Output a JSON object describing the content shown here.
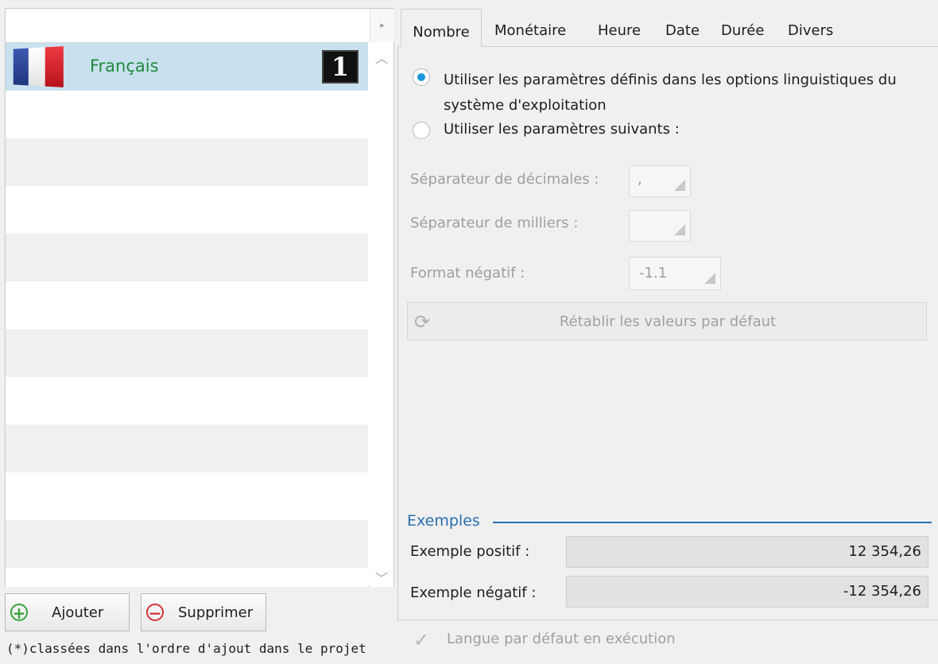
{
  "languages": {
    "items": [
      {
        "name": "Français",
        "order": "1",
        "flag_icon": "france-flag-icon"
      }
    ],
    "header_arrow": "▸",
    "scroll_up": "︿",
    "scroll_down": "﹀"
  },
  "buttons": {
    "add_label": "Ajouter",
    "add_icon": "+",
    "remove_label": "Supprimer",
    "remove_icon": "−"
  },
  "footnote": "(*)classées dans l'ordre d'ajout dans le projet",
  "tabs": [
    {
      "label": "Nombre",
      "active": true
    },
    {
      "label": "Monétaire"
    },
    {
      "label": "Heure"
    },
    {
      "label": "Date"
    },
    {
      "label": "Durée"
    },
    {
      "label": "Divers"
    }
  ],
  "options": {
    "use_os_settings": "Utiliser les paramètres définis dans les options linguistiques du système d'exploitation",
    "use_following": "Utiliser les paramètres suivants :",
    "selected": "use_os_settings"
  },
  "fields": {
    "decimal_separator": {
      "label": "Séparateur de décimales :",
      "value": ","
    },
    "thousands_separator": {
      "label": "Séparateur de milliers :",
      "value": ""
    },
    "negative_format": {
      "label": "Format négatif :",
      "value": "-1.1"
    }
  },
  "reset_button": {
    "label": "Rétablir les valeurs par défaut",
    "icon": "refresh-icon"
  },
  "examples": {
    "title": "Exemples",
    "positive_label": "Exemple positif :",
    "positive_value": "12 354,26",
    "negative_label": "Exemple négatif :",
    "negative_value": "-12 354,26"
  },
  "default_language": {
    "label": "Langue par défaut en exécution",
    "checked": true
  },
  "colors": {
    "accent": "#1a96d9",
    "selected_row": "#c9e1ef",
    "language_text": "#1f8a3a",
    "group_title": "#2a6fb0"
  }
}
